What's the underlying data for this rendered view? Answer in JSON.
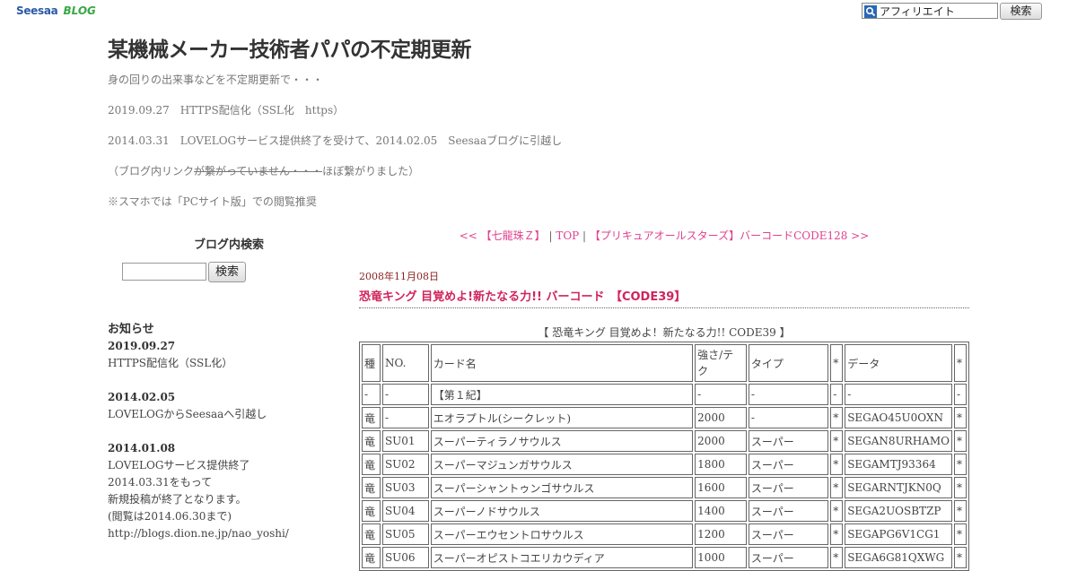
{
  "topbar": {
    "logo_seesaa": "Seesaa",
    "logo_blog": "BLOG",
    "search_value": "アフィリエイト",
    "search_button": "検索"
  },
  "header": {
    "title": "某機械メーカー技術者パパの不定期更新",
    "description": "身の回りの出来事などを不定期更新で・・・",
    "line1": "2019.09.27　HTTPS配信化（SSL化　https）",
    "line2": "2014.03.31　LOVELOGサービス提供終了を受けて、2014.02.05　Seesaaブログに引越し",
    "line3_prefix": "（ブログ内リンク",
    "line3_strike": "が繋がっていません・・・",
    "line3_suffix": "ほぼ繋がりました）",
    "line4": "※スマホでは「PCサイト版」での閲覧推奨"
  },
  "nav": {
    "prev": "<< 【七龍珠Ｚ】",
    "sep1": " | ",
    "top": "TOP",
    "sep2": " | ",
    "next": "【プリキュアオールスターズ】バーコードCODE128 >>"
  },
  "sidebar": {
    "search_heading": "ブログ内検索",
    "search_button": "検索",
    "news_heading": "お知らせ",
    "news": [
      {
        "date": "2019.09.27",
        "lines": [
          "HTTPS配信化（SSL化）"
        ]
      },
      {
        "date": "2014.02.05",
        "lines": [
          "LOVELOGからSeesaaへ引越し"
        ]
      },
      {
        "date": "2014.01.08",
        "lines": [
          "LOVELOGサービス提供終了",
          "2014.03.31をもって",
          "新規投稿が終了となります。",
          "(閲覧は2014.06.30まで)",
          "http://blogs.dion.ne.jp/nao_yoshi/"
        ]
      }
    ]
  },
  "post": {
    "date": "2008年11月08日",
    "title": "恐竜キング 目覚めよ!新たなる力!! バーコード　【CODE39】",
    "table_caption": "【 恐竜キング 目覚めよ！新たなる力!! CODE39 】",
    "table_headers": [
      "種",
      "NO.",
      "カード名",
      "強さ/テク",
      "タイプ",
      "*",
      "データ",
      "*"
    ],
    "table_rows": [
      [
        "-",
        "-",
        "【第１紀】",
        "-",
        "-",
        "-",
        "-",
        "-"
      ],
      [
        "竜",
        "-",
        "エオラプトル(シークレット)",
        "2000",
        "-",
        "*",
        "SEGAO45U0OXN",
        "*"
      ],
      [
        "竜",
        "SU01",
        "スーパーティラノサウルス",
        "2000",
        "スーパー",
        "*",
        "SEGAN8URHAMO",
        "*"
      ],
      [
        "竜",
        "SU02",
        "スーパーマジュンガサウルス",
        "1800",
        "スーパー",
        "*",
        "SEGAMTJ93364",
        "*"
      ],
      [
        "竜",
        "SU03",
        "スーパーシャントゥンゴサウルス",
        "1600",
        "スーパー",
        "*",
        "SEGARNTJKN0Q",
        "*"
      ],
      [
        "竜",
        "SU04",
        "スーパーノドサウルス",
        "1400",
        "スーパー",
        "*",
        "SEGA2UOSBTZP",
        "*"
      ],
      [
        "竜",
        "SU05",
        "スーパーエウセントロサウルス",
        "1200",
        "スーパー",
        "*",
        "SEGAPG6V1CG1",
        "*"
      ],
      [
        "竜",
        "SU06",
        "スーパーオピストコエリカウディア",
        "1000",
        "スーパー",
        "*",
        "SEGA6G81QXWG",
        "*"
      ]
    ]
  },
  "colors": {
    "link_pink": "#e0418f",
    "post_title": "#d0245c",
    "post_date": "#8b2323",
    "logo_blue": "#2a5aa5",
    "logo_green": "#39a845"
  }
}
